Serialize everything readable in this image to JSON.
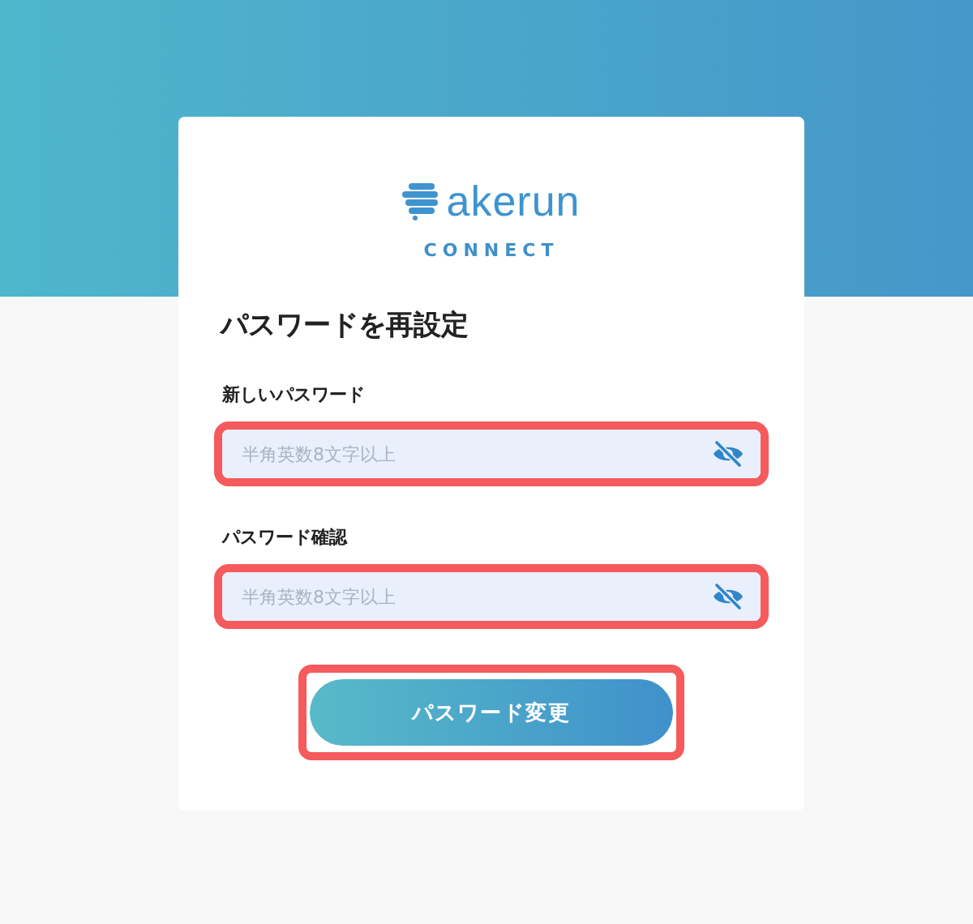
{
  "logo": {
    "wordmark": "akerun",
    "subtitle": "CONNECT"
  },
  "title": "パスワードを再設定",
  "fields": [
    {
      "label": "新しいパスワード",
      "placeholder": "半角英数8文字以上",
      "highlighted": true
    },
    {
      "label": "パスワード確認",
      "placeholder": "半角英数8文字以上",
      "highlighted": true
    }
  ],
  "submit": {
    "label": "パスワード変更",
    "highlighted": true
  }
}
